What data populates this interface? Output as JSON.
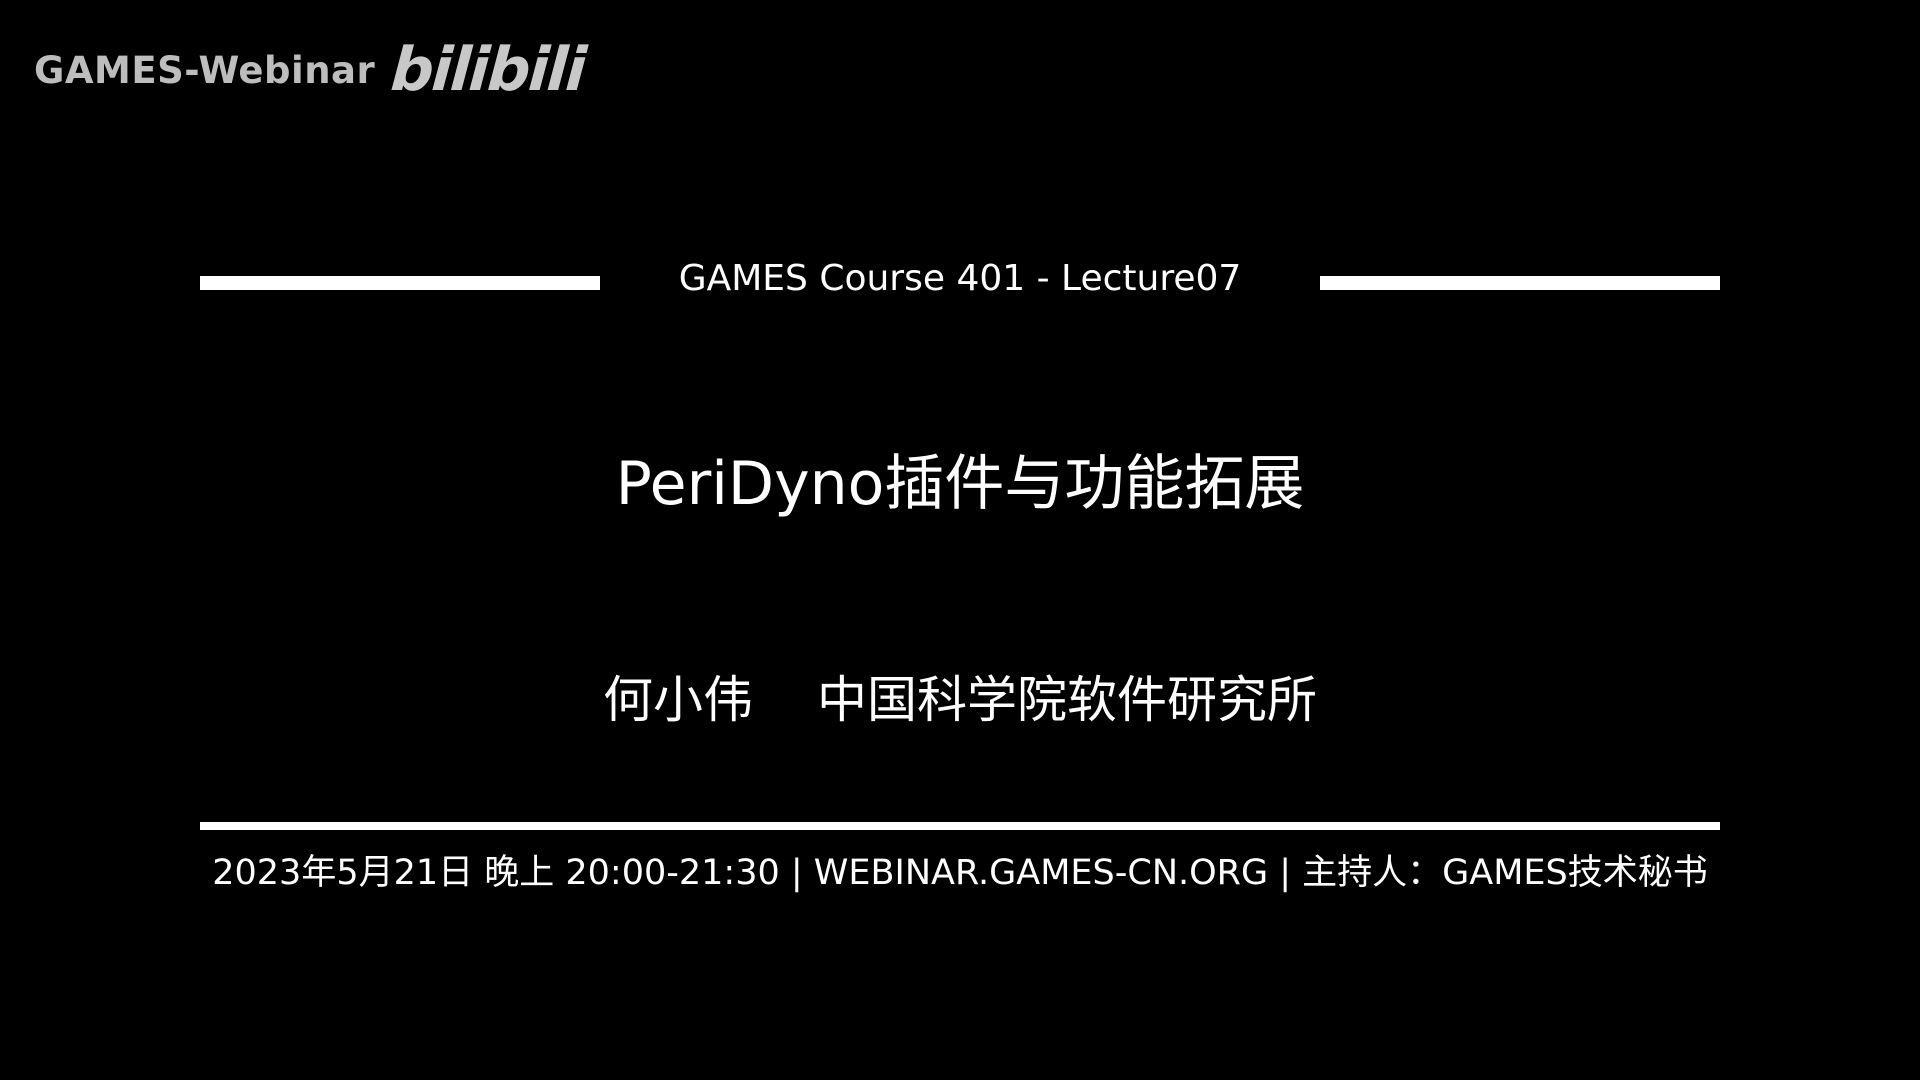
{
  "watermark": {
    "channel": "GAMES-Webinar",
    "logo": "bilibili"
  },
  "slide": {
    "course": "GAMES Course 401 - Lecture07",
    "title": "PeriDyno插件与功能拓展",
    "speaker": "何小伟",
    "affiliation": "中国科学院软件研究所",
    "info": "2023年5月21日 晚上 20:00-21:30 | WEBINAR.GAMES-CN.ORG | 主持人：GAMES技术秘书"
  },
  "colors": {
    "background": "#000000",
    "text": "#ffffff",
    "watermark": "#bdbdbd"
  }
}
